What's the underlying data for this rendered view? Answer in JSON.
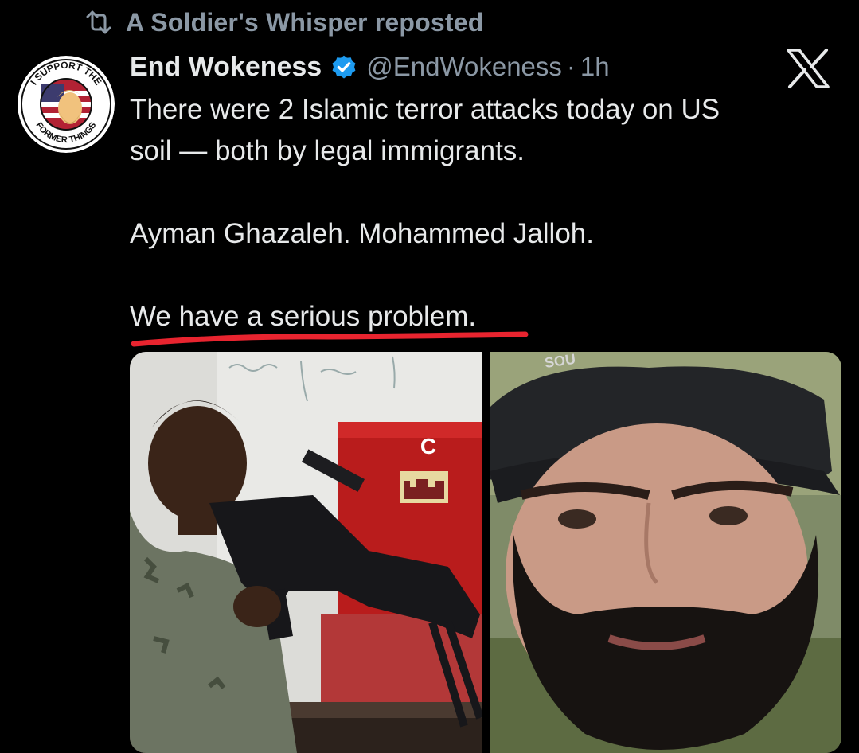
{
  "repost": {
    "icon": "repost-icon",
    "text": "A Soldier's Whisper reposted"
  },
  "author": {
    "name": "End Wokeness",
    "handle": "@EndWokeness",
    "separator": "·",
    "time": "1h",
    "verified_icon": "verified-badge-icon",
    "verified_color": "#1d9bf0",
    "avatar": {
      "icon": "avatar-badge",
      "top_text": "I SUPPORT THE",
      "bottom_text": "FORMER THINGS"
    }
  },
  "platform_logo": "x-logo",
  "tweet": {
    "lines": [
      "There were 2 Islamic terror attacks today on US",
      "soil — both by legal immigrants.",
      "Ayman Ghazaleh. Mohammed Jalloh.",
      "We have a serious problem."
    ],
    "underline_color": "#e8242f"
  },
  "media": {
    "left_photo": {
      "sign_letter": "C"
    },
    "right_photo": {
      "cap_text": "SOU"
    }
  },
  "colors": {
    "background": "#000000",
    "text_primary": "#e7e9ea",
    "text_secondary": "#8b98a5"
  }
}
